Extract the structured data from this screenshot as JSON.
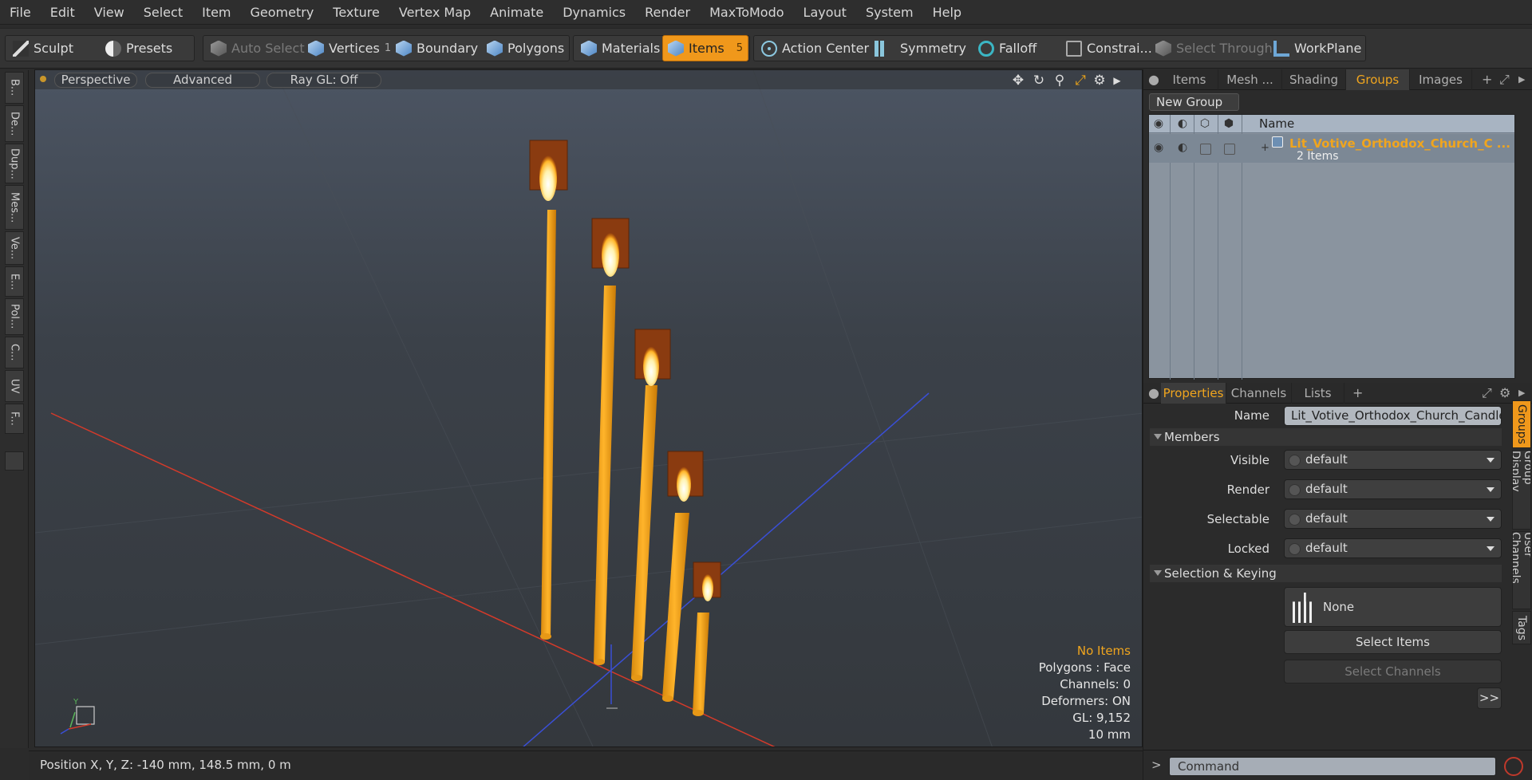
{
  "menu": [
    "File",
    "Edit",
    "View",
    "Select",
    "Item",
    "Geometry",
    "Texture",
    "Vertex Map",
    "Animate",
    "Dynamics",
    "Render",
    "MaxToModo",
    "Layout",
    "System",
    "Help"
  ],
  "toolbar": {
    "sculpt": "Sculpt",
    "presets": "Presets",
    "auto_select": "Auto Select",
    "vertices": "Vertices",
    "vertices_count": "1",
    "boundary": "Boundary",
    "polygons": "Polygons",
    "materials": "Materials",
    "items": "Items",
    "items_count": "5",
    "action_center": "Action Center",
    "symmetry": "Symmetry",
    "falloff": "Falloff",
    "constraints": "Constrai...",
    "select_through": "Select Through",
    "workplane": "WorkPlane"
  },
  "left_tabs": [
    "B...",
    "De...",
    "Dup...",
    "Mes...",
    "Ve...",
    "E...",
    "Pol...",
    "C...",
    "UV",
    "F..."
  ],
  "viewport": {
    "view": "Perspective",
    "shading": "Advanced",
    "raygl": "Ray GL: Off",
    "info": {
      "selection": "No Items",
      "polygons": "Polygons : Face",
      "channels": "Channels: 0",
      "deformers": "Deformers: ON",
      "gl": "GL: 9,152",
      "grid": "10 mm"
    }
  },
  "status": {
    "position": "Position X, Y, Z:  -140 mm, 148.5 mm, 0 m"
  },
  "right_tabs": [
    "Items",
    "Mesh ...",
    "Shading",
    "Groups",
    "Images"
  ],
  "groups": {
    "new_group": "New Group",
    "col_name": "Name",
    "row_name": "Lit_Votive_Orthodox_Church_C ...",
    "row_count": "2 Items"
  },
  "props_tabs": [
    "Properties",
    "Channels",
    "Lists"
  ],
  "props": {
    "name_label": "Name",
    "name_value": "Lit_Votive_Orthodox_Church_Candles",
    "members_section": "Members",
    "visible_label": "Visible",
    "visible_value": "default",
    "render_label": "Render",
    "render_value": "default",
    "selectable_label": "Selectable",
    "selectable_value": "default",
    "locked_label": "Locked",
    "locked_value": "default",
    "selection_section": "Selection & Keying",
    "none_btn": "None",
    "select_items_btn": "Select Items",
    "select_channels_btn": "Select Channels",
    "more_btn": ">>"
  },
  "side_tabs": [
    "Groups",
    "Group Display",
    "User Channels",
    "Tags"
  ],
  "command": {
    "placeholder": "Command"
  },
  "colors": {
    "accent": "#f0981b",
    "candle": "#f5a623",
    "axis_x": "#d43a2a",
    "axis_z": "#3a4fd6"
  }
}
